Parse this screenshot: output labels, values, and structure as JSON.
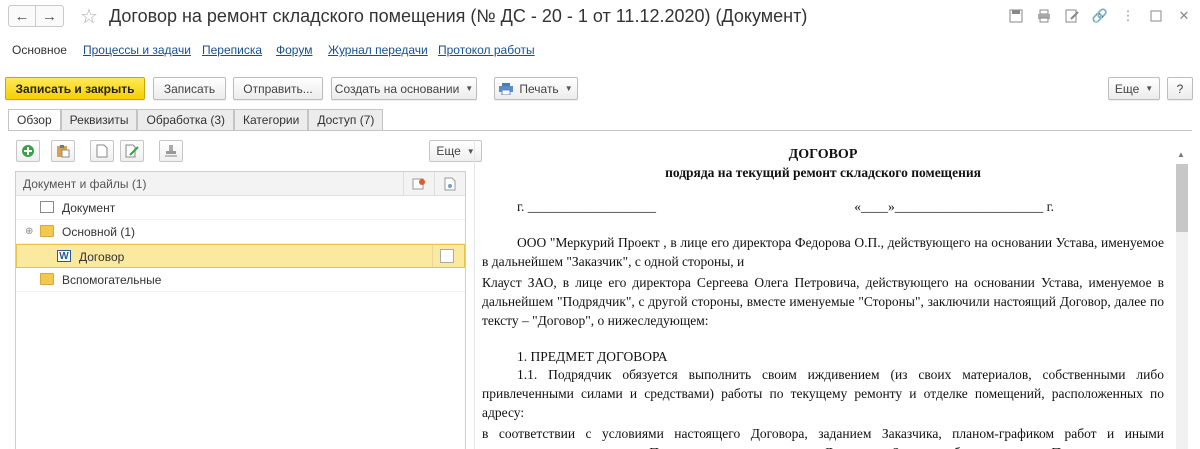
{
  "window": {
    "title": "Договор на ремонт складского помещения (№ ДС - 20 - 1 от 11.12.2020) (Документ)"
  },
  "nav_links": [
    {
      "label": "Основное"
    },
    {
      "label": "Процессы и задачи"
    },
    {
      "label": "Переписка"
    },
    {
      "label": "Форум"
    },
    {
      "label": "Журнал передачи"
    },
    {
      "label": "Протокол работы"
    }
  ],
  "toolbar": {
    "save_close": "Записать и закрыть",
    "save": "Записать",
    "send": "Отправить...",
    "create_based": "Создать на основании",
    "print": "Печать",
    "more": "Еще",
    "help": "?"
  },
  "tabs": [
    {
      "label": "Обзор"
    },
    {
      "label": "Реквизиты"
    },
    {
      "label": "Обработка (3)"
    },
    {
      "label": "Категории"
    },
    {
      "label": "Доступ (7)"
    }
  ],
  "files_panel": {
    "more": "Еще",
    "header": "Документ и файлы (1)",
    "rows": [
      {
        "label": "Документ"
      },
      {
        "label": "Основной (1)"
      },
      {
        "label": "Договор"
      },
      {
        "label": "Вспомогательные"
      }
    ]
  },
  "document": {
    "title": "ДОГОВОР",
    "subtitle": "подряда на текущий ремонт складского помещения",
    "place": "г. ___________________",
    "date": "«____»______________________ г.",
    "p1": "ООО \"Меркурий Проект , в лице его директора Федорова О.П., действующего на основании Устава, именуемое в дальнейшем \"Заказчик\", с одной стороны, и",
    "p2": "Клауст ЗАО, в лице его директора Сергеева Олега Петровича, действующего на основании Устава, именуемое в дальнейшем \"Подрядчик\", с другой стороны, вместе именуемые \"Стороны\", заключили настоящий Договор,  далее по тексту – \"Договор\",  о нижеследующем:",
    "section1": "1. ПРЕДМЕТ ДОГОВОРА",
    "p3": "1.1. Подрядчик обязуется выполнить своим иждивением (из своих материалов, собственными либо привлеченными силами и средствами) работы по текущему ремонту и отделке помещений, расположенных по адресу:",
    "p4": "в соответствии с условиями настоящего Договора, заданием Заказчика, планом-графиком работ и иными документами, являющимися Приложениями к настоящему Договору, а Заказчик обязуется создать Подрядчику"
  }
}
